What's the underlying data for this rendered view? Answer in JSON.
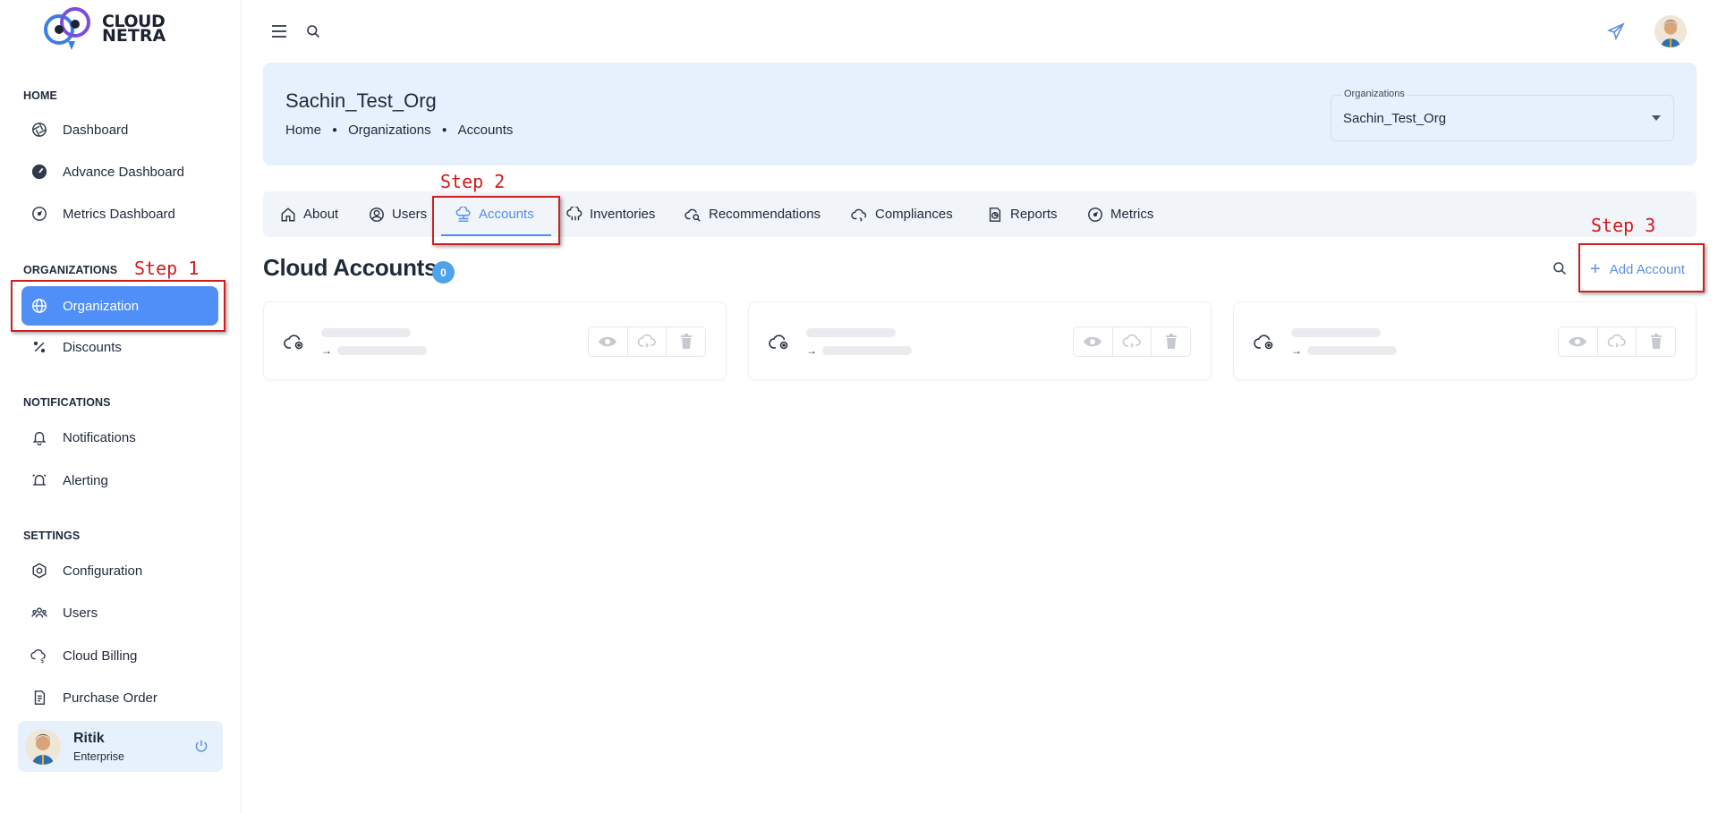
{
  "brand": {
    "logo_line1": "CLOUD",
    "logo_line2": "NETRA"
  },
  "sidebar": {
    "sections": {
      "home": "HOME",
      "organizations": "ORGANIZATIONS",
      "notifications": "NOTIFICATIONS",
      "settings": "SETTINGS"
    },
    "items": [
      {
        "label": "Dashboard",
        "icon": "aperture-icon"
      },
      {
        "label": "Advance Dashboard",
        "icon": "gauge-icon"
      },
      {
        "label": "Metrics Dashboard",
        "icon": "speedometer-icon"
      },
      {
        "label": "Organization",
        "icon": "globe-icon",
        "active": true
      },
      {
        "label": "Discounts",
        "icon": "percent-icon"
      },
      {
        "label": "Notifications",
        "icon": "bell-icon"
      },
      {
        "label": "Alerting",
        "icon": "alarm-icon"
      },
      {
        "label": "Configuration",
        "icon": "hexagon-settings-icon"
      },
      {
        "label": "Users",
        "icon": "users-icon"
      },
      {
        "label": "Cloud Billing",
        "icon": "cloud-dollar-icon"
      },
      {
        "label": "Purchase Order",
        "icon": "receipt-icon"
      }
    ],
    "user": {
      "name": "Ritik",
      "role": "Enterprise"
    }
  },
  "header": {
    "title": "Sachin_Test_Org",
    "breadcrumb": [
      "Home",
      "Organizations",
      "Accounts"
    ],
    "org_select": {
      "legend": "Organizations",
      "value": "Sachin_Test_Org"
    }
  },
  "tabs": [
    {
      "label": "About",
      "icon": "home-icon"
    },
    {
      "label": "Users",
      "icon": "user-circle-icon"
    },
    {
      "label": "Accounts",
      "icon": "cloud-network-icon",
      "active": true
    },
    {
      "label": "Inventories",
      "icon": "cloud-stack-icon"
    },
    {
      "label": "Recommendations",
      "icon": "cloud-search-icon"
    },
    {
      "label": "Compliances",
      "icon": "cloud-check-icon"
    },
    {
      "label": "Reports",
      "icon": "report-icon"
    },
    {
      "label": "Metrics",
      "icon": "gauge-icon"
    }
  ],
  "main": {
    "heading": "Cloud Accounts",
    "count": "0",
    "add_label": "Add Account",
    "cards": [
      {
        "arrow": "→"
      },
      {
        "arrow": "→"
      },
      {
        "arrow": "→"
      }
    ]
  },
  "annotations": {
    "step1": "Step 1",
    "step2": "Step 2",
    "step3": "Step 3"
  },
  "colors": {
    "accent": "#4f8ff7",
    "banner": "#e7f0fd",
    "annotation": "#cc2020"
  }
}
